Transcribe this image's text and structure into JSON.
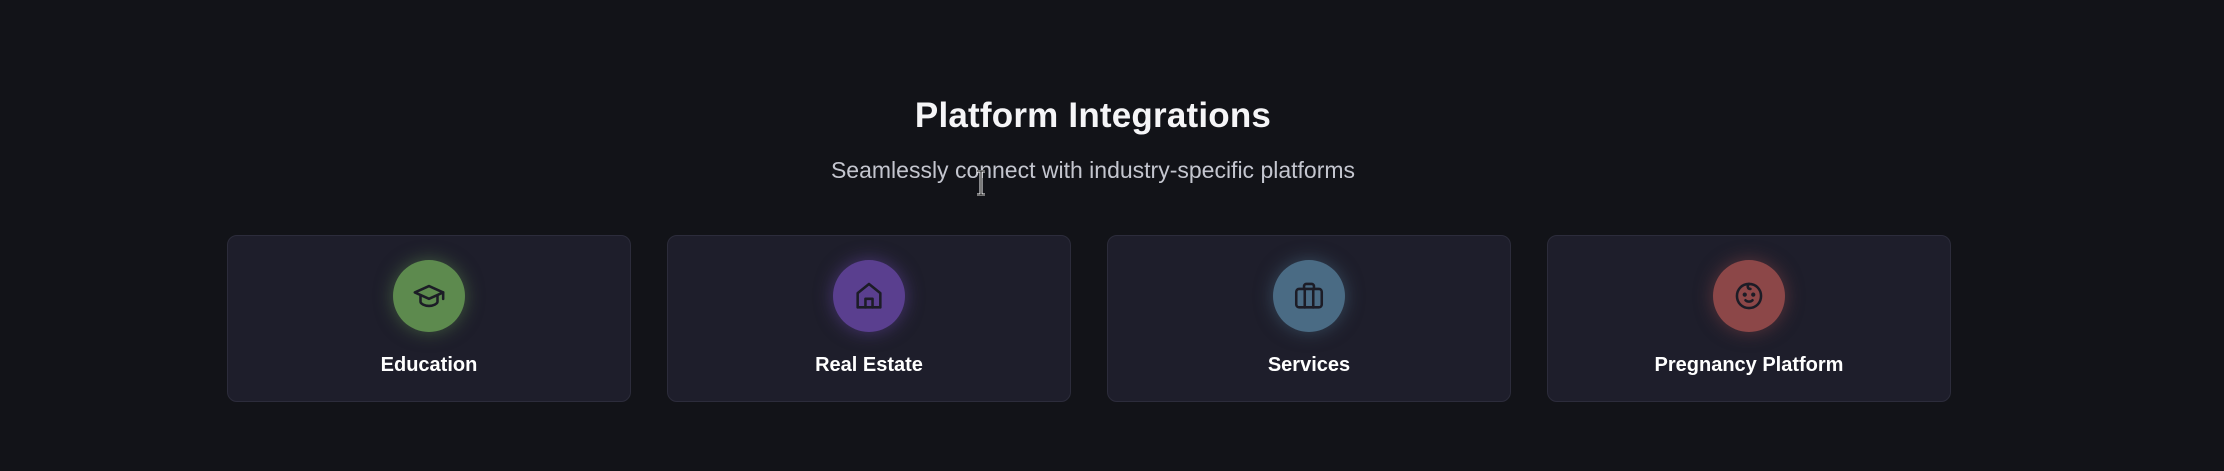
{
  "header": {
    "title": "Platform Integrations",
    "subtitle": "Seamlessly connect with industry-specific platforms"
  },
  "cards": [
    {
      "label": "Education",
      "icon": "graduation-cap-icon",
      "color": "#5d8a4e"
    },
    {
      "label": "Real Estate",
      "icon": "home-icon",
      "color": "#5a3f8f"
    },
    {
      "label": "Services",
      "icon": "briefcase-icon",
      "color": "#4a6b84"
    },
    {
      "label": "Pregnancy Platform",
      "icon": "baby-icon",
      "color": "#8c4748"
    }
  ],
  "theme": {
    "background": "#121318",
    "card_background": "#1e1e2b",
    "icon_stroke": "#1c1c26"
  }
}
